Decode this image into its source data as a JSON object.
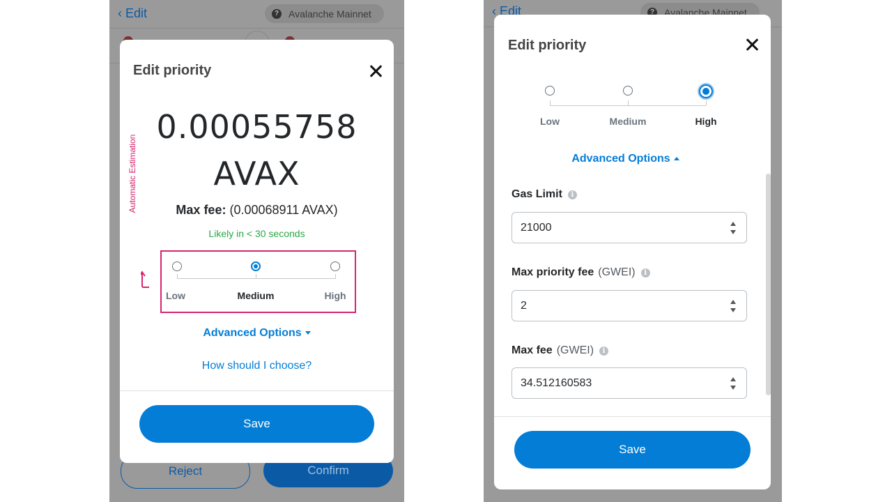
{
  "left_screen": {
    "background": {
      "back_label": "Edit",
      "network": "Avalanche Mainnet",
      "reject_label": "Reject",
      "confirm_label": "Confirm"
    },
    "modal": {
      "title": "Edit priority",
      "amount": "0.00055758",
      "currency": "AVAX",
      "max_fee_label": "Max fee:",
      "max_fee_value": "(0.00068911 AVAX)",
      "likely_text": "Likely in < 30 seconds",
      "annotation": "Automatic Estimation",
      "priority_options": [
        "Low",
        "Medium",
        "High"
      ],
      "selected_priority": "Medium",
      "advanced_options_label": "Advanced Options",
      "how_to_choose_label": "How should I choose?",
      "save_label": "Save"
    }
  },
  "right_screen": {
    "background": {
      "back_label": "Edit",
      "network": "Avalanche Mainnet"
    },
    "modal": {
      "title": "Edit priority",
      "priority_options": [
        "Low",
        "Medium",
        "High"
      ],
      "selected_priority": "High",
      "advanced_options_label": "Advanced Options",
      "fields": [
        {
          "label": "Gas Limit",
          "unit": "",
          "value": "21000"
        },
        {
          "label": "Max priority fee",
          "unit": "(GWEI)",
          "value": "2"
        },
        {
          "label": "Max fee",
          "unit": "(GWEI)",
          "value": "34.512160583"
        }
      ],
      "save_label": "Save"
    }
  },
  "colors": {
    "accent": "#037dd6",
    "success": "#28a745",
    "annotation": "#d6246e",
    "overlay": "#9a9a9a"
  },
  "icons": {
    "back": "chevron-left-icon",
    "network": "question-icon",
    "close": "close-icon",
    "info": "info-icon",
    "expand": "caret-down-icon",
    "collapse": "caret-up-icon",
    "stepper": "stepper-icon"
  }
}
